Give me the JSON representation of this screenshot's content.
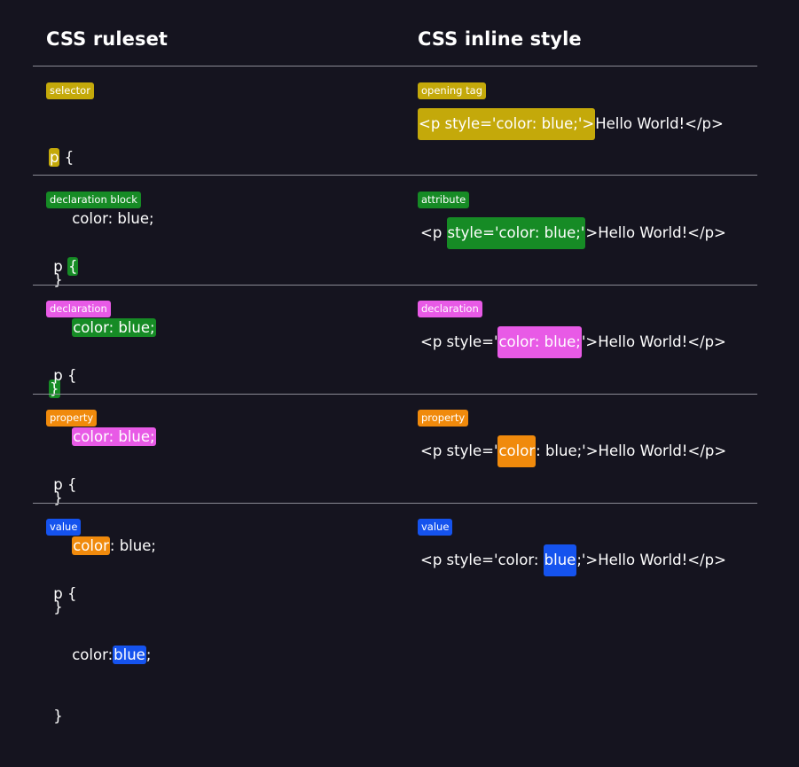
{
  "headers": {
    "ruleset": "CSS ruleset",
    "inline": "CSS inline style"
  },
  "rows": [
    {
      "ruleset_tag": "selector",
      "inline_tag": "opening tag",
      "color": "#c4a90a"
    },
    {
      "ruleset_tag": "declaration block",
      "inline_tag": "attribute",
      "color": "#168b25"
    },
    {
      "ruleset_tag": "declaration",
      "inline_tag": "declaration",
      "color": "#e85ae6"
    },
    {
      "ruleset_tag": "property",
      "inline_tag": "property",
      "color": "#f08a0c"
    },
    {
      "ruleset_tag": "value",
      "inline_tag": "value",
      "color": "#1553ee"
    }
  ],
  "code": {
    "selector": "p",
    "open_brace": "{",
    "close_brace": "}",
    "declaration": "color: blue;",
    "property": "color",
    "colon_space": ": ",
    "value": "blue",
    "semicolon": ";",
    "opening_tag": "<p style='color: blue;'>",
    "tag_start": "<p ",
    "attribute": "style='color: blue;'",
    "attr_prefix": "style='",
    "attr_suffix": "'",
    "after_tag": ">Hello World!</p>",
    "content_and_close": "Hello World!</p>"
  }
}
